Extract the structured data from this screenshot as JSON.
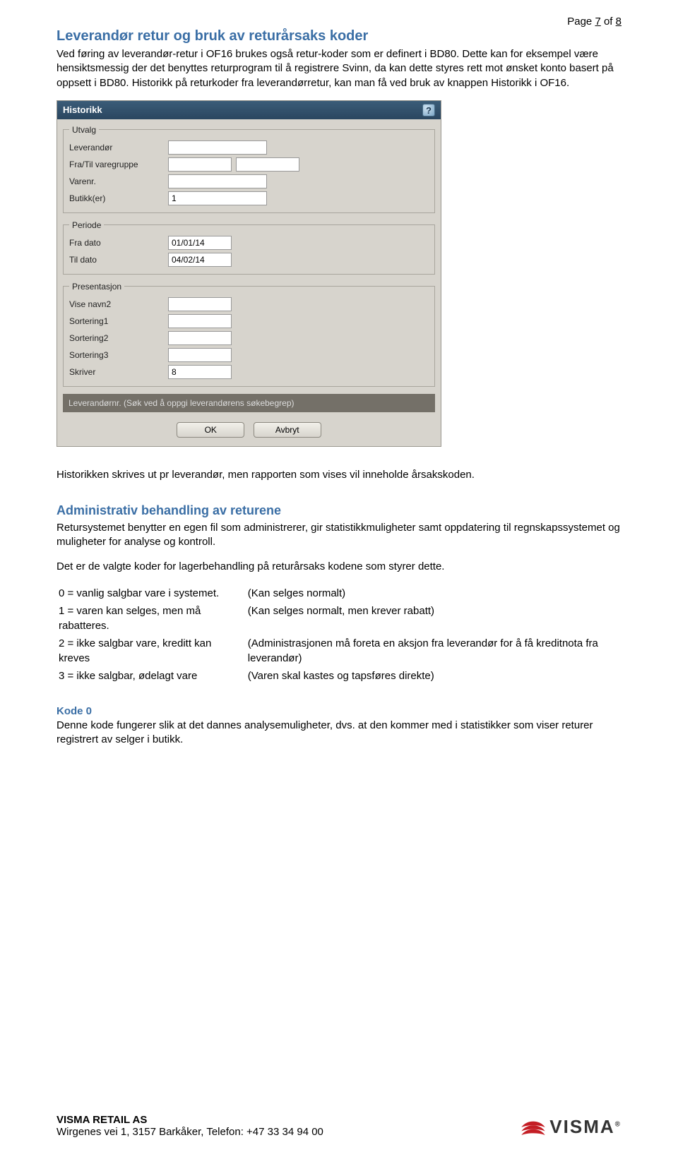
{
  "page": {
    "label": "Page",
    "current": "7",
    "of": "of",
    "total": "8"
  },
  "section1": {
    "title": "Leverandør retur og bruk av returårsaks koder",
    "para1": "Ved føring av leverandør-retur i OF16 brukes også retur-koder som er definert i BD80. Dette kan for eksempel være hensiktsmessig der det benyttes returprogram til å registrere Svinn, da kan dette styres rett mot ønsket konto basert på oppsett i BD80. Historikk på returkoder fra leverandørretur, kan man få ved bruk av knappen Historikk i OF16."
  },
  "dialog": {
    "title": "Historikk",
    "help_icon": "?",
    "groups": {
      "utvalg": {
        "legend": "Utvalg",
        "leverandor": "Leverandør",
        "fratil": "Fra/Til varegruppe",
        "varenr": "Varenr.",
        "butikker": "Butikk(er)",
        "butikker_val": "1"
      },
      "periode": {
        "legend": "Periode",
        "fra": "Fra dato",
        "fra_val": "01/01/14",
        "til": "Til dato",
        "til_val": "04/02/14"
      },
      "presentasjon": {
        "legend": "Presentasjon",
        "navn2": "Vise navn2",
        "sort1": "Sortering1",
        "sort2": "Sortering2",
        "sort3": "Sortering3",
        "skriver": "Skriver",
        "skriver_val": "8"
      }
    },
    "hint": "Leverandørnr. (Søk ved å oppgi leverandørens søkebegrep)",
    "ok": "OK",
    "cancel": "Avbryt"
  },
  "para2": "Historikken skrives ut pr leverandør, men rapporten som vises vil inneholde årsakskoden.",
  "section2": {
    "title": "Administrativ behandling av returene",
    "para1": "Retursystemet benytter en egen fil som administrerer, gir statistikkmuligheter samt oppdatering til regnskapssystemet og muligheter for analyse og kontroll.",
    "para2": "Det er de valgte koder for lagerbehandling på returårsaks kodene som styrer dette.",
    "codes": [
      {
        "left": "0 = vanlig salgbar vare i systemet.",
        "right": "(Kan selges normalt)"
      },
      {
        "left": "1 = varen kan selges, men må rabatteres.",
        "right": "(Kan selges normalt, men krever rabatt)"
      },
      {
        "left": "2 = ikke salgbar vare, kreditt kan kreves",
        "right": "(Administrasjonen må foreta en aksjon fra leverandør for å få kreditnota fra leverandør)"
      },
      {
        "left": "3 = ikke salgbar, ødelagt vare",
        "right": "(Varen skal kastes og tapsføres direkte)"
      }
    ]
  },
  "kode0": {
    "title": "Kode 0",
    "text": "Denne kode fungerer slik at det dannes analysemuligheter, dvs. at den kommer med i statistikker som viser returer registrert av selger i butikk."
  },
  "footer": {
    "company": "VISMA RETAIL AS",
    "address": "Wirgenes vei 1, 3157 Barkåker, Telefon: +47 33 34 94 00",
    "logo": "VISMA"
  }
}
